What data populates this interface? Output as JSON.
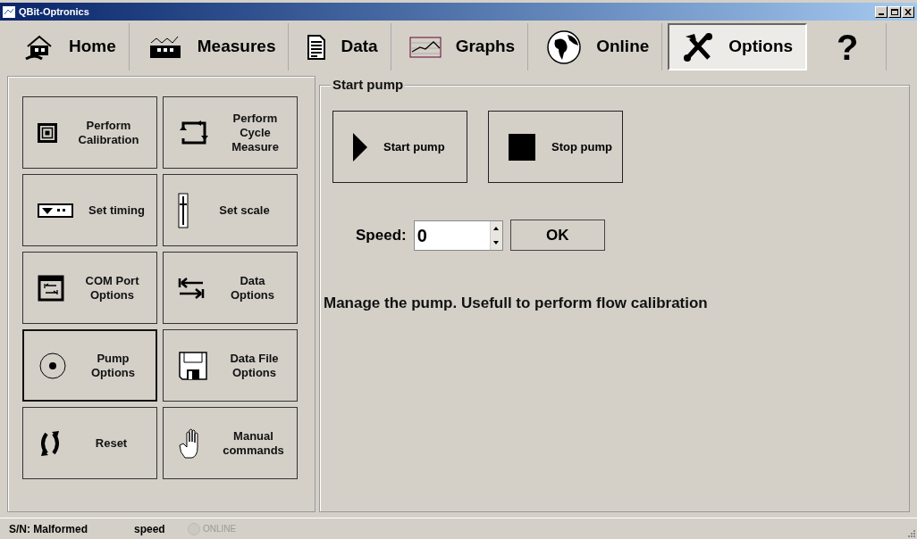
{
  "window": {
    "title": "QBit-Optronics"
  },
  "toolbar": {
    "tabs": [
      {
        "label": "Home",
        "selected": false
      },
      {
        "label": "Measures",
        "selected": false
      },
      {
        "label": "Data",
        "selected": false
      },
      {
        "label": "Graphs",
        "selected": false
      },
      {
        "label": "Online",
        "selected": false
      },
      {
        "label": "Options",
        "selected": true
      }
    ],
    "help": "?"
  },
  "options": [
    {
      "label": "Perform Calibration",
      "selected": false
    },
    {
      "label": "Perform Cycle Measure",
      "selected": false
    },
    {
      "label": "Set timing",
      "selected": false
    },
    {
      "label": "Set scale",
      "selected": false
    },
    {
      "label": "COM Port Options",
      "selected": false
    },
    {
      "label": "Data Options",
      "selected": false
    },
    {
      "label": "Pump Options",
      "selected": true
    },
    {
      "label": "Data File Options",
      "selected": false
    },
    {
      "label": "Reset",
      "selected": false
    },
    {
      "label": "Manual commands",
      "selected": false
    }
  ],
  "group": {
    "title": "Start pump",
    "buttons": [
      "Start pump",
      "Stop pump"
    ],
    "speed_label": "Speed:",
    "speed_value": "0",
    "ok": "OK",
    "description": "Manage the pump. Usefull to perform flow calibration"
  },
  "status_bar": {
    "serial": "S/N: Malformed",
    "speed": "speed",
    "online": {
      "label": "ONLINE",
      "on": false
    }
  }
}
